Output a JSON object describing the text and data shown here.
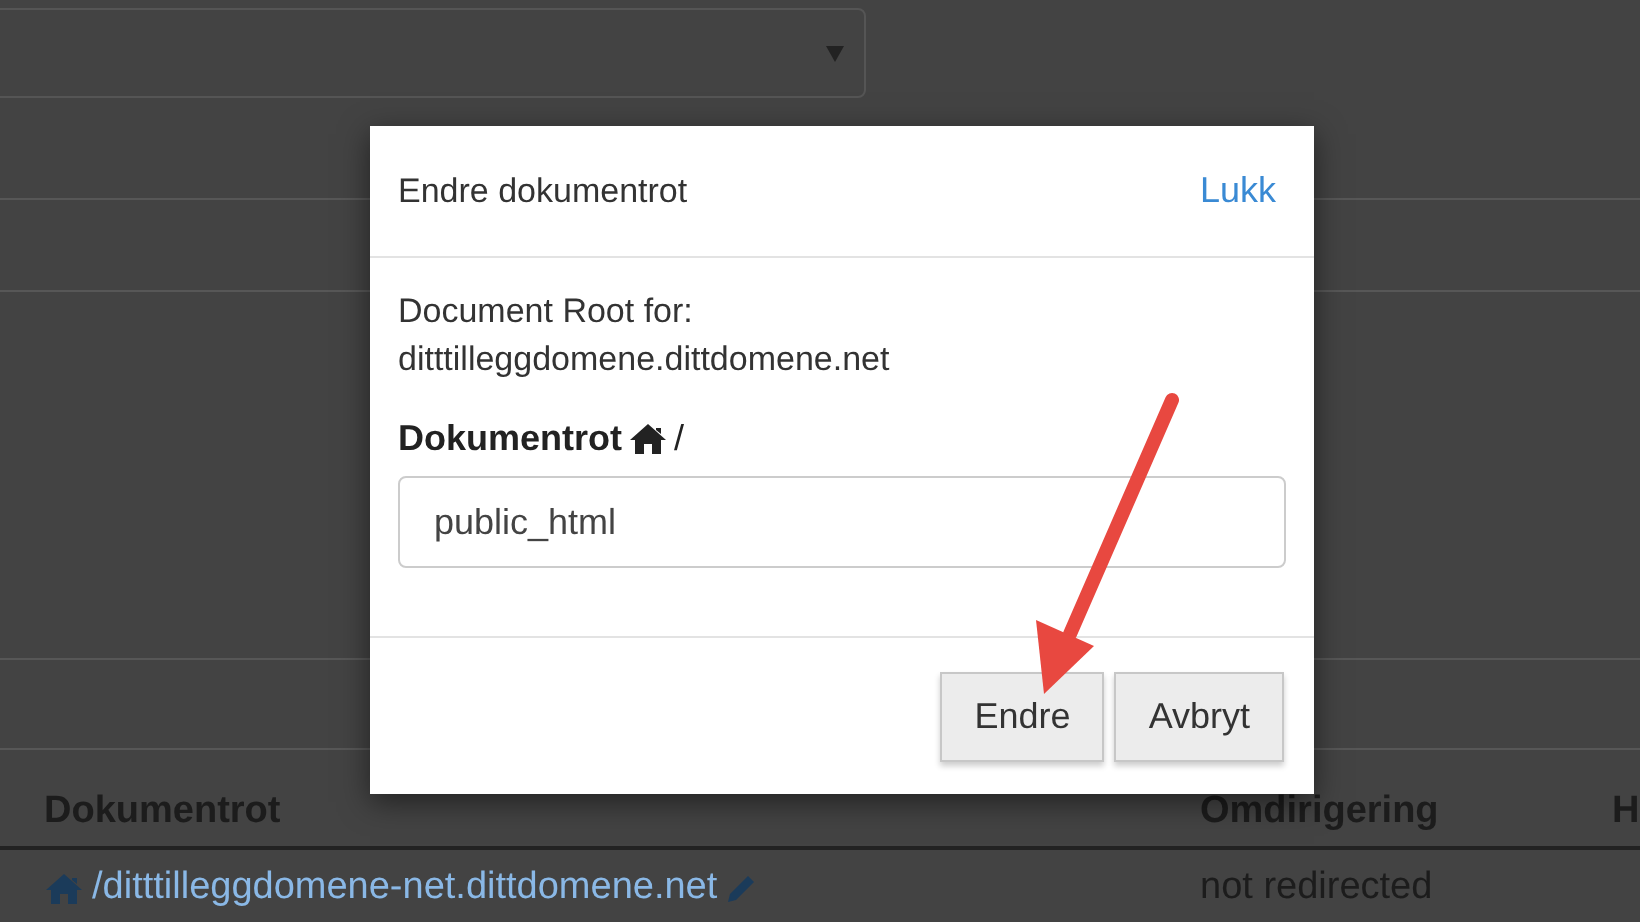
{
  "page": {
    "table": {
      "columns": [
        "Dokumentrot",
        "Omdirigering",
        "H"
      ],
      "rows": [
        {
          "document_root": "/ditttilleggdomene-net.dittdomene.net",
          "redirection": "not redirected"
        }
      ]
    }
  },
  "dialog": {
    "title": "Endre dokumentrot",
    "close_link": "Lukk",
    "description": "Document Root for:",
    "domain": "ditttilleggdomene.dittdomene.net",
    "field_label": "Dokumentrot",
    "path_prefix": "/",
    "field_value": "public_html",
    "buttons": [
      "Endre",
      "Avbryt"
    ]
  }
}
